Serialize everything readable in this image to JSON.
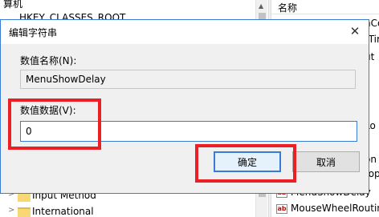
{
  "background": {
    "tree_top_fragments": [
      "算机",
      "HKEY_CLASSES_ROOT",
      "H"
    ],
    "tree_items": [
      {
        "label": "Input Method"
      },
      {
        "label": "International"
      }
    ],
    "values_header": "名称",
    "value_fragments": [
      "nCo",
      "tTir",
      "ut",
      "Lo",
      "on",
      "top"
    ],
    "value_items": [
      {
        "icon": "ab",
        "label": "MenuShowDelay"
      },
      {
        "icon": "ab",
        "label": "MouseWheelRouting"
      }
    ]
  },
  "dialog": {
    "title": "编辑字符串",
    "close_glyph": "✕",
    "name_label": "数值名称(N):",
    "name_value": "MenuShowDelay",
    "data_label": "数值数据(V):",
    "data_value": "0",
    "ok_label": "确定",
    "cancel_label": "取消"
  },
  "colors": {
    "annotation": "#ec1f24",
    "accent": "#3a7bd5"
  }
}
